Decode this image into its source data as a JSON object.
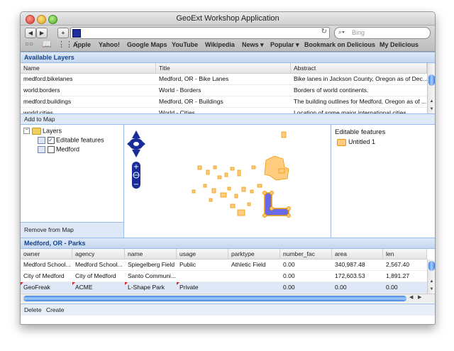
{
  "window": {
    "title": "GeoExt Workshop Application"
  },
  "browser": {
    "search_placeholder": "Bing",
    "bookmarks": [
      "Apple",
      "Yahoo!",
      "Google Maps",
      "YouTube",
      "Wikipedia",
      "News ▾",
      "Popular ▾",
      "Bookmark on Delicious",
      "My Delicious"
    ]
  },
  "layers_panel": {
    "title": "Available Layers",
    "columns": [
      "Name",
      "Title",
      "Abstract"
    ],
    "rows": [
      [
        "medford:bikelanes",
        "Medford, OR - Bike Lanes",
        "Bike lanes in Jackson County, Oregon as of Dec..."
      ],
      [
        "world:borders",
        "World - Borders",
        "Borders of world continents."
      ],
      [
        "medford:buildings",
        "Medford, OR - Buildings",
        "The building outlines for Medford, Oregon as of ..."
      ],
      [
        "world:cities",
        "World - Cities",
        "Location of some major international cities"
      ]
    ],
    "add_button": "Add to Map"
  },
  "tree": {
    "root": "Layers",
    "items": [
      "Editable features",
      "Medford"
    ],
    "remove_button": "Remove from Map"
  },
  "legend": {
    "title": "Editable features",
    "item": "Untitled 1",
    "fill_color": "#ffcc80",
    "stroke_color": "#ee9900"
  },
  "map": {
    "edit_fill": "#6a6ae8",
    "edit_stroke": "#ee9900"
  },
  "parks_panel": {
    "title": "Medford, OR - Parks",
    "columns": [
      "owner",
      "agency",
      "name",
      "usage",
      "parktype",
      "number_fac",
      "area",
      "len"
    ],
    "rows": [
      [
        "Medford School...",
        "Medford School...",
        "Spiegelberg Field",
        "Public",
        "Athletic Field",
        "0.00",
        "340,987.48",
        "2,567.40"
      ],
      [
        "City of Medford",
        "City of Medford",
        "Santo Communi...",
        "",
        "",
        "0.00",
        "172,603.53",
        "1,891.27"
      ],
      [
        "GeoFreak",
        "ACME",
        "L-Shape Park",
        "Private",
        "",
        "0.00",
        "0.00",
        "0.00"
      ]
    ],
    "delete_button": "Delete",
    "create_button": "Create"
  }
}
